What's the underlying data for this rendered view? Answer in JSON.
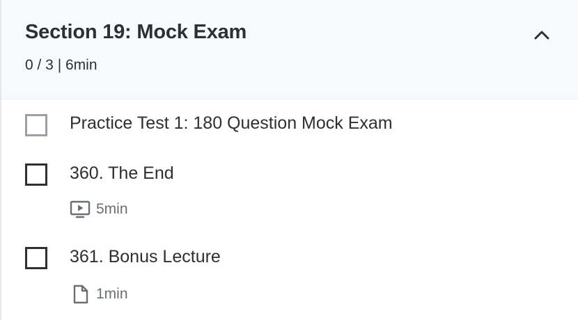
{
  "section": {
    "title": "Section 19: Mock Exam",
    "progress": "0 / 3 | 6min",
    "expanded": true,
    "toggle_icon": "chevron-up-icon"
  },
  "items": [
    {
      "title": "Practice Test 1: 180 Question Mock Exam",
      "completed": false,
      "checkbox_style": "light",
      "type": "practice-test"
    },
    {
      "title": "360. The End",
      "completed": false,
      "type": "video",
      "icon": "video-icon",
      "duration": "5min"
    },
    {
      "title": "361. Bonus Lecture",
      "completed": false,
      "type": "article",
      "icon": "file-icon",
      "duration": "1min"
    }
  ],
  "colors": {
    "text": "#2d2f31",
    "muted": "#6a6f73",
    "header_bg": "#f7f9fa",
    "checkbox_light": "#9aa0a6"
  }
}
